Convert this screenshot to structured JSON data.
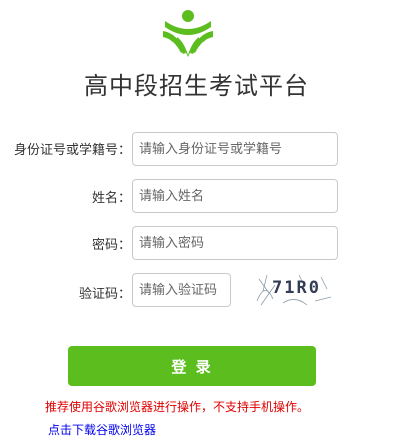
{
  "app": {
    "title": "高中段招生考试平台"
  },
  "form": {
    "id_label": "身份证号或学籍号：",
    "id_placeholder": "请输入身份证号或学籍号",
    "name_label": "姓名：",
    "name_placeholder": "请输入姓名",
    "password_label": "密码：",
    "password_placeholder": "请输入密码",
    "captcha_label": "验证码：",
    "captcha_placeholder": "请输入验证码",
    "captcha_text": "71R0"
  },
  "actions": {
    "login_label": "登 录"
  },
  "footer": {
    "notice": "推荐使用谷歌浏览器进行操作，不支持手机操作。",
    "download_link": "点击下载谷歌浏览器"
  },
  "colors": {
    "accent": "#5cbd1f",
    "notice": "#e00000",
    "link": "#0000ee"
  },
  "icons": {
    "logo": "green-book-sprout-logo"
  }
}
